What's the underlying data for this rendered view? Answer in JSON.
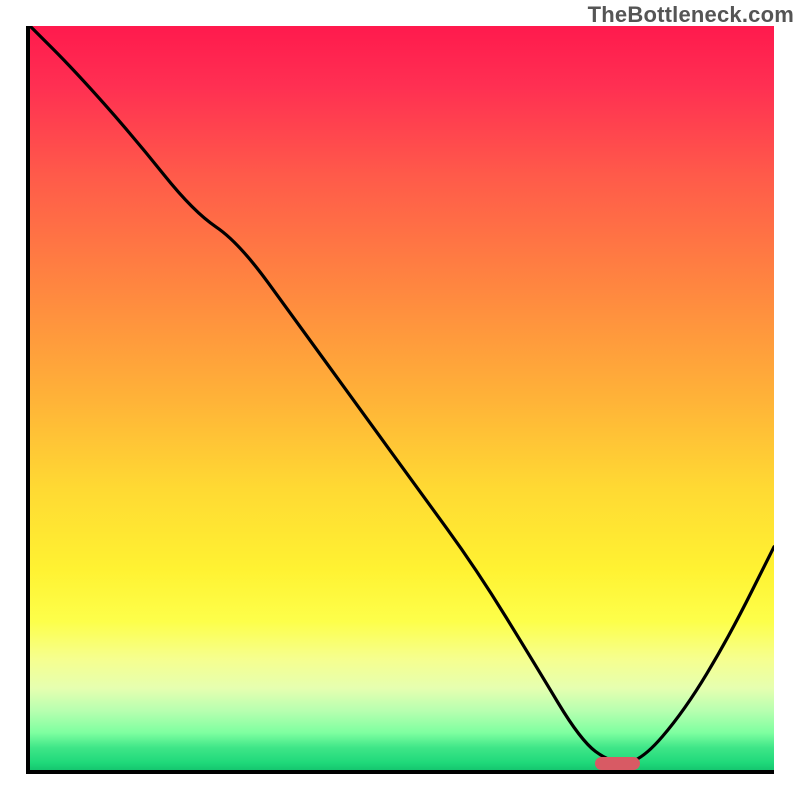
{
  "watermark": "TheBottleneck.com",
  "colors": {
    "axis": "#000000",
    "curve": "#000000",
    "marker": "#d85a64",
    "gradient_stops": [
      "#ff1a4d",
      "#ff2f52",
      "#ff5a4a",
      "#ff8640",
      "#ffb238",
      "#ffd933",
      "#fff232",
      "#fdff4a",
      "#f6ff8e",
      "#e6ffb0",
      "#b8ffb0",
      "#7effa0",
      "#3fe688",
      "#1fd97a",
      "#15c66f"
    ]
  },
  "chart_data": {
    "type": "line",
    "title": "",
    "xlabel": "",
    "ylabel": "",
    "xlim": [
      0,
      100
    ],
    "ylim": [
      0,
      100
    ],
    "grid": false,
    "legend": false,
    "series": [
      {
        "name": "bottleneck-curve",
        "x": [
          0,
          6,
          14,
          22,
          28,
          36,
          44,
          52,
          60,
          68,
          74,
          78,
          82,
          88,
          94,
          100
        ],
        "y": [
          100,
          94,
          85,
          75,
          71,
          60,
          49,
          38,
          27,
          14,
          4,
          1,
          1,
          8,
          18,
          30
        ]
      }
    ],
    "marker": {
      "name": "optimal-zone",
      "x_start": 76,
      "x_end": 82,
      "y": 0
    }
  }
}
